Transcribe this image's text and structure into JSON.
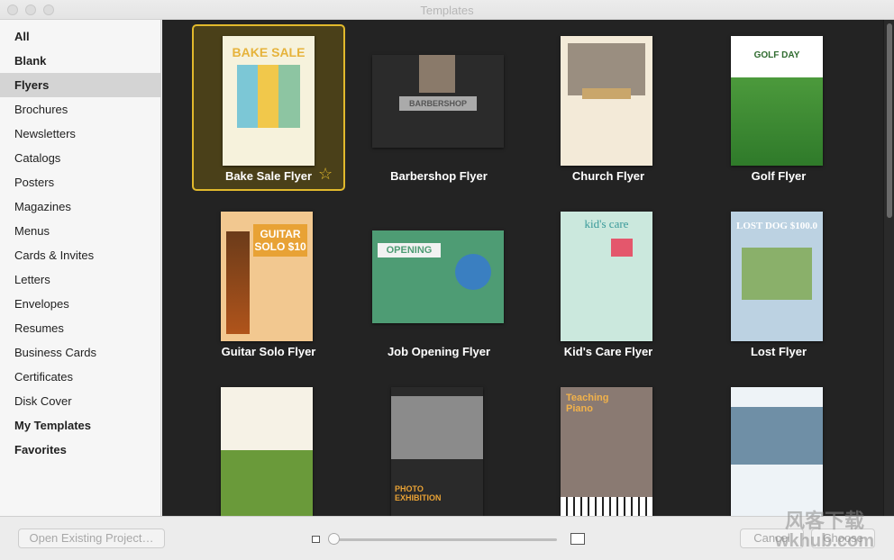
{
  "window": {
    "title": "Templates"
  },
  "sidebar": {
    "items": [
      {
        "label": "All",
        "bold": true
      },
      {
        "label": "Blank",
        "bold": true
      },
      {
        "label": "Flyers",
        "bold": true,
        "selected": true
      },
      {
        "label": "Brochures"
      },
      {
        "label": "Newsletters"
      },
      {
        "label": "Catalogs"
      },
      {
        "label": "Posters"
      },
      {
        "label": "Magazines"
      },
      {
        "label": "Menus"
      },
      {
        "label": "Cards & Invites"
      },
      {
        "label": "Letters"
      },
      {
        "label": "Envelopes"
      },
      {
        "label": "Resumes"
      },
      {
        "label": "Business Cards"
      },
      {
        "label": "Certificates"
      },
      {
        "label": "Disk Cover"
      },
      {
        "label": "My Templates",
        "bold": true
      },
      {
        "label": "Favorites",
        "bold": true
      }
    ]
  },
  "templates": [
    {
      "name": "Bake Sale Flyer",
      "thumb_text": "BAKE SALE",
      "selected": true,
      "favorite": true
    },
    {
      "name": "Barbershop Flyer",
      "thumb_text": "BARBERSHOP"
    },
    {
      "name": "Church Flyer",
      "thumb_text": ""
    },
    {
      "name": "Golf Flyer",
      "thumb_text": "GOLF DAY"
    },
    {
      "name": "Guitar Solo Flyer",
      "thumb_text": "GUITAR SOLO $10"
    },
    {
      "name": "Job Opening Flyer",
      "thumb_text": "OPENING"
    },
    {
      "name": "Kid's Care Flyer",
      "thumb_text": "kid's care"
    },
    {
      "name": "Lost Flyer",
      "thumb_text": "LOST DOG $100.0"
    },
    {
      "name": "",
      "thumb_text": ""
    },
    {
      "name": "",
      "thumb_text": "PHOTO EXHIBITION"
    },
    {
      "name": "",
      "thumb_text": "Teaching Piano"
    },
    {
      "name": "",
      "thumb_text": ""
    }
  ],
  "footer": {
    "open_existing": "Open Existing Project…",
    "cancel": "Cancel",
    "choose": "Choose"
  },
  "watermark": {
    "line1": "风客下载",
    "line2": "wkhub.com"
  },
  "colors": {
    "selection": "#e1b92c",
    "grid_bg": "#232323",
    "sidebar_selected": "#d4d4d4"
  }
}
